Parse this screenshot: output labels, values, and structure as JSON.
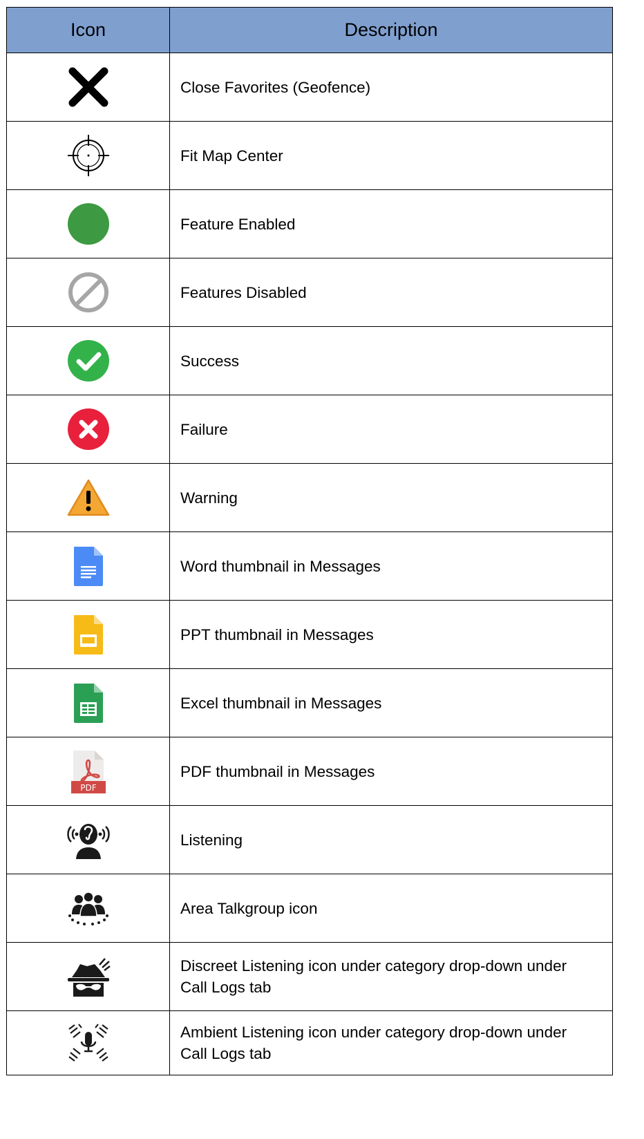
{
  "table": {
    "headers": {
      "icon": "Icon",
      "description": "Description"
    },
    "rows": [
      {
        "icon": "close-x-icon",
        "description": "Close Favorites (Geofence)"
      },
      {
        "icon": "crosshair-icon",
        "description": "Fit Map Center"
      },
      {
        "icon": "green-dot-icon",
        "description": "Feature Enabled"
      },
      {
        "icon": "disabled-icon",
        "description": "Features Disabled"
      },
      {
        "icon": "success-check-icon",
        "description": "Success"
      },
      {
        "icon": "failure-x-icon",
        "description": "Failure"
      },
      {
        "icon": "warning-icon",
        "description": "Warning"
      },
      {
        "icon": "word-document-icon",
        "description": "Word thumbnail in Messages"
      },
      {
        "icon": "ppt-slides-icon",
        "description": "PPT thumbnail in Messages"
      },
      {
        "icon": "excel-sheet-icon",
        "description": "Excel thumbnail in Messages"
      },
      {
        "icon": "pdf-file-icon",
        "description": "PDF thumbnail in Messages"
      },
      {
        "icon": "listening-icon",
        "description": "Listening"
      },
      {
        "icon": "area-talkgroup-icon",
        "description": "Area Talkgroup icon"
      },
      {
        "icon": "discreet-listening-icon",
        "description": "Discreet Listening icon under category drop-down under Call Logs tab"
      },
      {
        "icon": "ambient-listening-icon",
        "description": "Ambient Listening icon under category drop-down under Call Logs tab"
      }
    ]
  },
  "colors": {
    "header_bg": "#7f9fcf",
    "enabled_green": "#3d9a42",
    "success_green": "#33b24a",
    "failure_red": "#e8203c",
    "warning_orange": "#f4a733",
    "word_blue": "#4c8bf5",
    "ppt_yellow": "#f6bb17",
    "excel_green": "#2ba055",
    "pdf_red": "#d04a45",
    "disabled_gray": "#a6a6a6"
  }
}
